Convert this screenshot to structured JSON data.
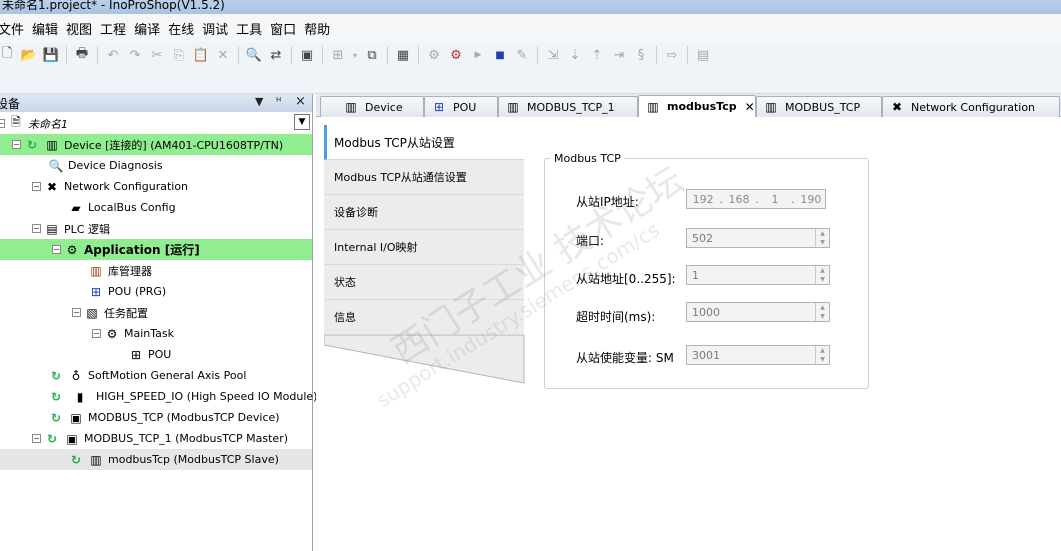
{
  "window": {
    "title": "未命名1.project* - InoProShop(V1.5.2)"
  },
  "menu": [
    "文件",
    "编辑",
    "视图",
    "工程",
    "编译",
    "在线",
    "调试",
    "工具",
    "窗口",
    "帮助"
  ],
  "toolbar": {
    "buttons": [
      "new-icon",
      "open-icon",
      "save-icon",
      "print-icon",
      "undo-icon",
      "redo-icon",
      "cut-icon",
      "copy-icon",
      "paste-icon",
      "delete-icon",
      "find-icon",
      "replace-icon",
      "object-icon",
      "grid-icon",
      "add-icon",
      "build-icon",
      "login-icon",
      "logout-icon",
      "run-icon",
      "stop-icon",
      "reset-icon",
      "step-icon",
      "breakpoint-icon",
      "watch-icon"
    ]
  },
  "device_pane": {
    "title": "设备",
    "pin": "ᴴ",
    "close": "×",
    "tree": [
      {
        "label": "未命名1",
        "italic": true
      },
      {
        "label": "Device [连接的] (AM401-CPU1608TP/TN)"
      },
      {
        "label": "Device Diagnosis"
      },
      {
        "label": "Network Configuration"
      },
      {
        "label": "LocalBus Config"
      },
      {
        "label": "PLC 逻辑"
      },
      {
        "label": "Application [运行]"
      },
      {
        "label": "库管理器"
      },
      {
        "label": "POU (PRG)"
      },
      {
        "label": "任务配置"
      },
      {
        "label": "MainTask"
      },
      {
        "label": "POU"
      },
      {
        "label": "SoftMotion General Axis Pool"
      },
      {
        "label": "HIGH_SPEED_IO (High Speed IO Module)"
      },
      {
        "label": "MODBUS_TCP (ModbusTCP Device)"
      },
      {
        "label": "MODBUS_TCP_1 (ModbusTCP Master)"
      },
      {
        "label": "modbusTcp (ModbusTCP Slave)"
      }
    ]
  },
  "tabs": [
    {
      "label": "Device"
    },
    {
      "label": "POU"
    },
    {
      "label": "MODBUS_TCP_1"
    },
    {
      "label": "modbusTcp",
      "active": true,
      "close": "✕"
    },
    {
      "label": "MODBUS_TCP"
    },
    {
      "label": "Network Configuration"
    }
  ],
  "editor": {
    "nav": [
      {
        "label": "Modbus TCP从站设置",
        "active": true
      },
      {
        "label": "Modbus TCP从站通信设置"
      },
      {
        "label": "设备诊断"
      },
      {
        "label": "Internal I/O映射"
      },
      {
        "label": "状态"
      },
      {
        "label": "信息"
      }
    ],
    "group_title": "Modbus TCP",
    "fields": {
      "ip_label": "从站IP地址:",
      "ip": [
        "192",
        "168",
        "1",
        "190"
      ],
      "port_label": "端口:",
      "port": "502",
      "addr_label": "从站地址[0..255]:",
      "addr": "1",
      "timeout_label": "超时时间(ms):",
      "timeout": "1000",
      "enable_label": "从站使能变量: SM",
      "enable": "3001"
    }
  },
  "watermark": {
    "line1": "西门子工业 技术论坛",
    "line2": "support.industry.siemens.com/cs"
  }
}
